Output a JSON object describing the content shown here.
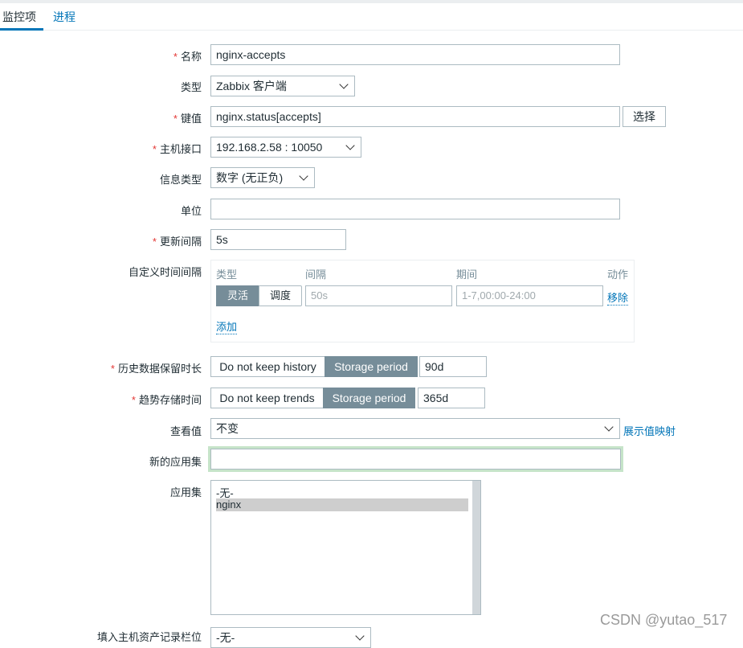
{
  "tabs": [
    "监控项",
    "进程"
  ],
  "form": {
    "name": {
      "label": "名称",
      "value": "nginx-accepts"
    },
    "type": {
      "label": "类型",
      "value": "Zabbix 客户端"
    },
    "key": {
      "label": "键值",
      "value": "nginx.status[accepts]",
      "button": "选择"
    },
    "interface": {
      "label": "主机接口",
      "value": "192.168.2.58 : 10050"
    },
    "info_type": {
      "label": "信息类型",
      "value": "数字 (无正负)"
    },
    "units": {
      "label": "单位",
      "value": ""
    },
    "update_interval": {
      "label": "更新间隔",
      "value": "5s"
    },
    "custom_intervals": {
      "label": "自定义时间间隔",
      "headers": [
        "类型",
        "间隔",
        "期间",
        "动作"
      ],
      "type_options": [
        "灵活",
        "调度"
      ],
      "interval_placeholder": "50s",
      "period_placeholder": "1-7,00:00-24:00",
      "remove": "移除",
      "add": "添加"
    },
    "history": {
      "label": "历史数据保留时长",
      "options": [
        "Do not keep history",
        "Storage period"
      ],
      "value": "90d"
    },
    "trends": {
      "label": "趋势存储时间",
      "options": [
        "Do not keep trends",
        "Storage period"
      ],
      "value": "365d"
    },
    "valuemap": {
      "label": "查看值",
      "value": "不变",
      "link": "展示值映射"
    },
    "new_app": {
      "label": "新的应用集",
      "value": ""
    },
    "apps": {
      "label": "应用集",
      "items": [
        "-无-",
        "nginx"
      ]
    },
    "inventory": {
      "label": "填入主机资产记录栏位",
      "value": "-无-"
    }
  },
  "watermark": "CSDN @yutao_517"
}
